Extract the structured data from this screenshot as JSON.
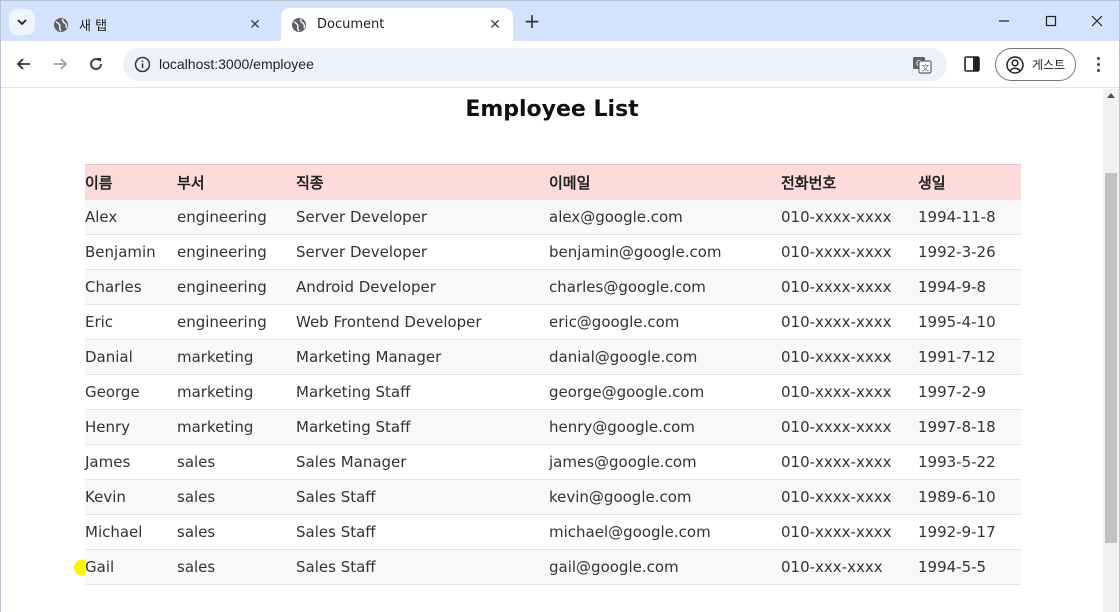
{
  "browser": {
    "tabs": [
      {
        "title": "새 탭",
        "active": false
      },
      {
        "title": "Document",
        "active": true
      }
    ],
    "url": "localhost:3000/employee",
    "profile_label": "게스트",
    "new_tab_symbol": "+",
    "close_symbol": "✕"
  },
  "page": {
    "title": "Employee List",
    "columns": [
      "이름",
      "부서",
      "직종",
      "이메일",
      "전화번호",
      "생일"
    ],
    "rows": [
      [
        "Alex",
        "engineering",
        "Server Developer",
        "alex@google.com",
        "010-xxxx-xxxx",
        "1994-11-8"
      ],
      [
        "Benjamin",
        "engineering",
        "Server Developer",
        "benjamin@google.com",
        "010-xxxx-xxxx",
        "1992-3-26"
      ],
      [
        "Charles",
        "engineering",
        "Android Developer",
        "charles@google.com",
        "010-xxxx-xxxx",
        "1994-9-8"
      ],
      [
        "Eric",
        "engineering",
        "Web Frontend Developer",
        "eric@google.com",
        "010-xxxx-xxxx",
        "1995-4-10"
      ],
      [
        "Danial",
        "marketing",
        "Marketing Manager",
        "danial@google.com",
        "010-xxxx-xxxx",
        "1991-7-12"
      ],
      [
        "George",
        "marketing",
        "Marketing Staff",
        "george@google.com",
        "010-xxxx-xxxx",
        "1997-2-9"
      ],
      [
        "Henry",
        "marketing",
        "Marketing Staff",
        "henry@google.com",
        "010-xxxx-xxxx",
        "1997-8-18"
      ],
      [
        "James",
        "sales",
        "Sales Manager",
        "james@google.com",
        "010-xxxx-xxxx",
        "1993-5-22"
      ],
      [
        "Kevin",
        "sales",
        "Sales Staff",
        "kevin@google.com",
        "010-xxxx-xxxx",
        "1989-6-10"
      ],
      [
        "Michael",
        "sales",
        "Sales Staff",
        "michael@google.com",
        "010-xxxx-xxxx",
        "1992-9-17"
      ],
      [
        "Gail",
        "sales",
        "Sales Staff",
        "gail@google.com",
        "010-xxx-xxxx",
        "1994-5-5"
      ]
    ]
  },
  "colors": {
    "header_row": "#fddbdb",
    "tabstrip": "#d3e3fd",
    "highlight": "#f5f500"
  },
  "icons": {
    "tab_search": "chevron-down-icon",
    "tab_favicon": "globe-icon",
    "back": "arrow-left-icon",
    "forward": "arrow-right-icon",
    "reload": "reload-icon",
    "site_info": "info-icon",
    "translate": "translate-icon",
    "side_panel": "side-panel-icon",
    "profile": "person-icon",
    "menu": "more-vert-icon"
  }
}
